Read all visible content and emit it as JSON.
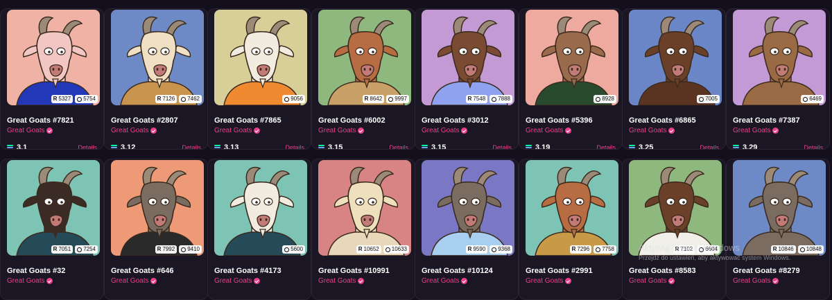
{
  "collection_verified_icon": "verified-check-icon",
  "details_label": "Details",
  "currency_icon": "solana-icon",
  "watermark": {
    "line1": "Aktywuj system Windows",
    "line2": "Przejdź do ustawień, aby aktywować system Windows."
  },
  "colors": {
    "accent": "#e8418f",
    "background": "#140f1c",
    "card": "#1b1624"
  },
  "cards": [
    {
      "name": "Great Goats #7821",
      "collection": "Great Goats",
      "price": "3,1",
      "rank": "5327",
      "score": "5754",
      "bg": "#efb2a4",
      "fur": "#f2c6c2",
      "shirt": "#2338b8"
    },
    {
      "name": "Great Goats #2807",
      "collection": "Great Goats",
      "price": "3,12",
      "rank": "7126",
      "score": "7462",
      "bg": "#6e8ac6",
      "fur": "#efe0c4",
      "shirt": "#c8944e"
    },
    {
      "name": "Great Goats #7865",
      "collection": "Great Goats",
      "price": "3,13",
      "rank": "",
      "score": "9056",
      "bg": "#d8cf98",
      "fur": "#f1ecdf",
      "shirt": "#f08a30"
    },
    {
      "name": "Great Goats #6002",
      "collection": "Great Goats",
      "price": "3,15",
      "rank": "8642",
      "score": "9997",
      "bg": "#8eb87e",
      "fur": "#b86c42",
      "shirt": "#c8a068"
    },
    {
      "name": "Great Goats #3012",
      "collection": "Great Goats",
      "price": "3,15",
      "rank": "7548",
      "score": "7888",
      "bg": "#c49ad4",
      "fur": "#7a4a32",
      "shirt": "#8ea2f0"
    },
    {
      "name": "Great Goats #5396",
      "collection": "Great Goats",
      "price": "3,19",
      "rank": "",
      "score": "8928",
      "bg": "#efaaa0",
      "fur": "#9a6a4c",
      "shirt": "#2a4a2e"
    },
    {
      "name": "Great Goats #6865",
      "collection": "Great Goats",
      "price": "3,25",
      "rank": "",
      "score": "7005",
      "bg": "#6b86c6",
      "fur": "#6a4028",
      "shirt": "#5a3420"
    },
    {
      "name": "Great Goats #7387",
      "collection": "Great Goats",
      "price": "3,29",
      "rank": "",
      "score": "6469",
      "bg": "#c49ad6",
      "fur": "#9a6a44",
      "shirt": "#9a6a44"
    },
    {
      "name": "Great Goats #32",
      "collection": "Great Goats",
      "price": "",
      "rank": "7051",
      "score": "7254",
      "bg": "#7ec4b4",
      "fur": "#3a2c24",
      "shirt": "#254a58"
    },
    {
      "name": "Great Goats #646",
      "collection": "Great Goats",
      "price": "",
      "rank": "7992",
      "score": "9410",
      "bg": "#ef9a76",
      "fur": "#7a6c60",
      "shirt": "#2a2a2a"
    },
    {
      "name": "Great Goats #4173",
      "collection": "Great Goats",
      "price": "",
      "rank": "",
      "score": "5600",
      "bg": "#7ec4b4",
      "fur": "#f1ecdf",
      "shirt": "#254a58"
    },
    {
      "name": "Great Goats #10991",
      "collection": "Great Goats",
      "price": "",
      "rank": "10652",
      "score": "10633",
      "bg": "#d88484",
      "fur": "#eee0bc",
      "shirt": "#e6d8b8"
    },
    {
      "name": "Great Goats #10124",
      "collection": "Great Goats",
      "price": "",
      "rank": "9590",
      "score": "9368",
      "bg": "#7a78c4",
      "fur": "#7a6c60",
      "shirt": "#a8cef0"
    },
    {
      "name": "Great Goats #2991",
      "collection": "Great Goats",
      "price": "",
      "rank": "7296",
      "score": "7758",
      "bg": "#7ec4b4",
      "fur": "#b86c42",
      "shirt": "#c89a48"
    },
    {
      "name": "Great Goats #8583",
      "collection": "Great Goats",
      "price": "",
      "rank": "7102",
      "score": "6604",
      "bg": "#8eb87e",
      "fur": "#6a4028",
      "shirt": "#f0efe8"
    },
    {
      "name": "Great Goats #8279",
      "collection": "Great Goats",
      "price": "",
      "rank": "10846",
      "score": "10848",
      "bg": "#6e8ac6",
      "fur": "#7a6c60",
      "shirt": "#7a6c60"
    }
  ]
}
